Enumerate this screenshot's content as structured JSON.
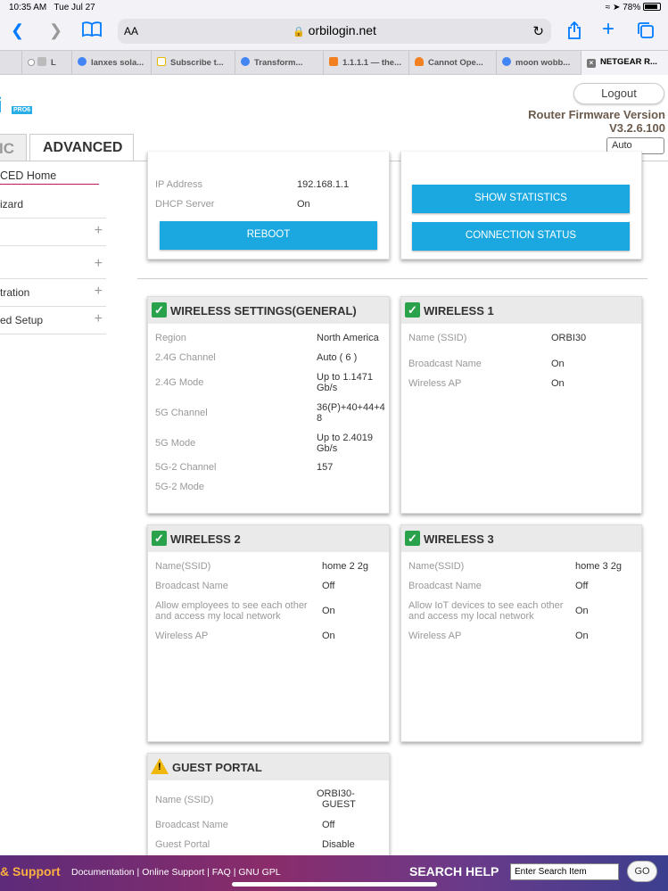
{
  "status_bar": {
    "time": "10:35 AM",
    "date": "Tue Jul 27",
    "battery": "78%"
  },
  "browser": {
    "text_size": "AA",
    "url": "orbilogin.net",
    "tabs": [
      {
        "label": "L"
      },
      {
        "label": "lanxes sola..."
      },
      {
        "label": "Subscribe t..."
      },
      {
        "label": "Transform..."
      },
      {
        "label": "1.1.1.1 — the..."
      },
      {
        "label": "Cannot Ope..."
      },
      {
        "label": "moon wobb..."
      },
      {
        "label": "NETGEAR R..."
      }
    ]
  },
  "header": {
    "logo_letters": "i",
    "logo_badge": "PRO6",
    "logout": "Logout",
    "firmware_label": "Router Firmware Version",
    "firmware_version": "V3.2.6.100",
    "auto_select": "Auto",
    "tab_basic": "IC",
    "tab_advanced": "ADVANCED"
  },
  "sidebar": {
    "items": [
      {
        "label": "CED Home"
      },
      {
        "label": "izard"
      },
      {
        "label": ""
      },
      {
        "label": ""
      },
      {
        "label": "tration"
      },
      {
        "label": "ed Setup"
      }
    ]
  },
  "internet_panel": {
    "rows": [
      {
        "label": "IP Address",
        "value": "192.168.1.1"
      },
      {
        "label": "DHCP Server",
        "value": "On"
      }
    ],
    "reboot": "REBOOT"
  },
  "actions": {
    "show_statistics": "SHOW STATISTICS",
    "connection_status": "CONNECTION STATUS"
  },
  "wireless_general": {
    "title": "WIRELESS SETTINGS(GENERAL)",
    "rows": [
      {
        "label": "Region",
        "value": "North America"
      },
      {
        "label": "2.4G Channel",
        "value": "Auto ( 6 )"
      },
      {
        "label": "2.4G Mode",
        "value": "Up to 1.1471 Gb/s"
      },
      {
        "label": "5G Channel",
        "value": "36(P)+40+44+48"
      },
      {
        "label": "5G Mode",
        "value": "Up to 2.4019 Gb/s"
      },
      {
        "label": "5G-2 Channel",
        "value": "157"
      },
      {
        "label": "5G-2 Mode",
        "value": ""
      }
    ]
  },
  "wireless1": {
    "title": "WIRELESS 1",
    "rows": [
      {
        "label": "Name (SSID)",
        "value": "ORBI30"
      },
      {
        "label": "Broadcast Name",
        "value": "On"
      },
      {
        "label": "Wireless AP",
        "value": "On"
      }
    ]
  },
  "wireless2": {
    "title": "WIRELESS 2",
    "rows": [
      {
        "label": "Name(SSID)",
        "value": "home 2 2g"
      },
      {
        "label": "Broadcast Name",
        "value": "Off"
      },
      {
        "label": "Allow employees to see each other and access my local network",
        "value": "On"
      },
      {
        "label": "Wireless AP",
        "value": "On"
      }
    ]
  },
  "wireless3": {
    "title": "WIRELESS 3",
    "rows": [
      {
        "label": "Name(SSID)",
        "value": "home 3 2g"
      },
      {
        "label": "Broadcast Name",
        "value": "Off"
      },
      {
        "label": "Allow IoT devices to see each other and access my local network",
        "value": "On"
      },
      {
        "label": "Wireless AP",
        "value": "On"
      }
    ]
  },
  "guest_portal": {
    "title": "GUEST PORTAL",
    "rows": [
      {
        "label": "Name (SSID)",
        "value": "ORBI30-GUEST"
      },
      {
        "label": "Broadcast Name",
        "value": "Off"
      },
      {
        "label": "Guest Portal",
        "value": "Disable"
      }
    ]
  },
  "footer": {
    "support": "& Support",
    "links": [
      "Documentation",
      "Online Support",
      "FAQ",
      "GNU GPL"
    ],
    "search_help": "SEARCH HELP",
    "search_placeholder": "Enter Search Item",
    "go": "GO"
  },
  "colors": {
    "accent_blue": "#1ba8e0",
    "check_green": "#2aa24b",
    "footer_purple": "#5d2b7a",
    "safari_blue": "#007aff"
  }
}
